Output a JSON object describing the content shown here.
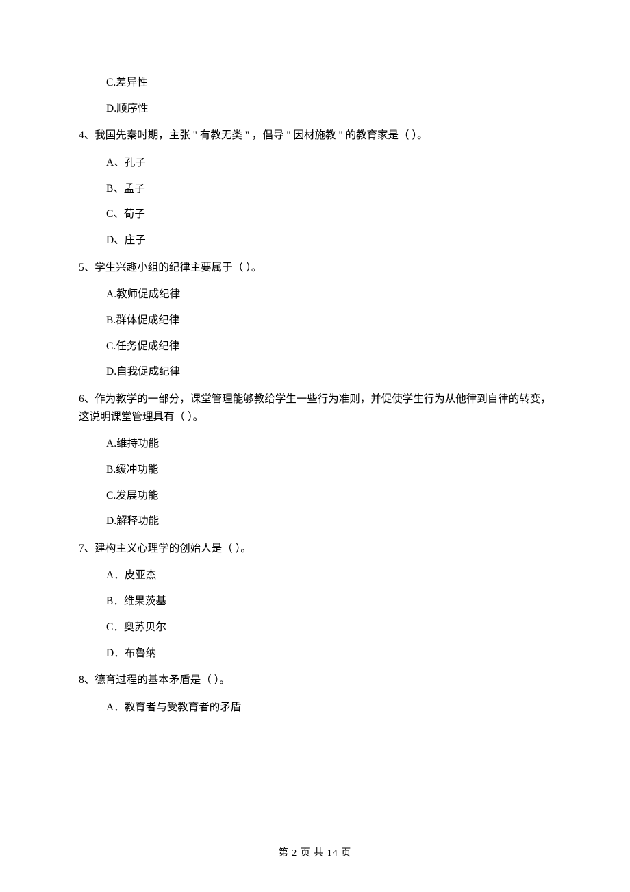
{
  "q3_options_cont": {
    "c": "C.差异性",
    "d": "D.顺序性"
  },
  "q4": {
    "stem": "4、我国先秦时期，主张 \" 有教无类 \" ，倡导 \" 因材施教 \" 的教育家是（    ）。",
    "a": "A、孔子",
    "b": "B、孟子",
    "c": "C、荀子",
    "d": "D、庄子"
  },
  "q5": {
    "stem": "5、学生兴趣小组的纪律主要属于（    ）。",
    "a": "A.教师促成纪律",
    "b": "B.群体促成纪律",
    "c": "C.任务促成纪律",
    "d": "D.自我促成纪律"
  },
  "q6": {
    "stem": "6、作为教学的一部分，课堂管理能够教给学生一些行为准则，并促使学生行为从他律到自律的转变，这说明课堂管理具有（    ）。",
    "a": "A.维持功能",
    "b": "B.缓冲功能",
    "c": "C.发展功能",
    "d": "D.解释功能"
  },
  "q7": {
    "stem": "7、建构主义心理学的创始人是（    ）。",
    "a": "A．皮亚杰",
    "b": "B．维果茨基",
    "c": "C．奥苏贝尔",
    "d": "D．布鲁纳"
  },
  "q8": {
    "stem": "8、德育过程的基本矛盾是（    ）。",
    "a": "A．教育者与受教育者的矛盾"
  },
  "footer": "第 2 页 共 14 页"
}
